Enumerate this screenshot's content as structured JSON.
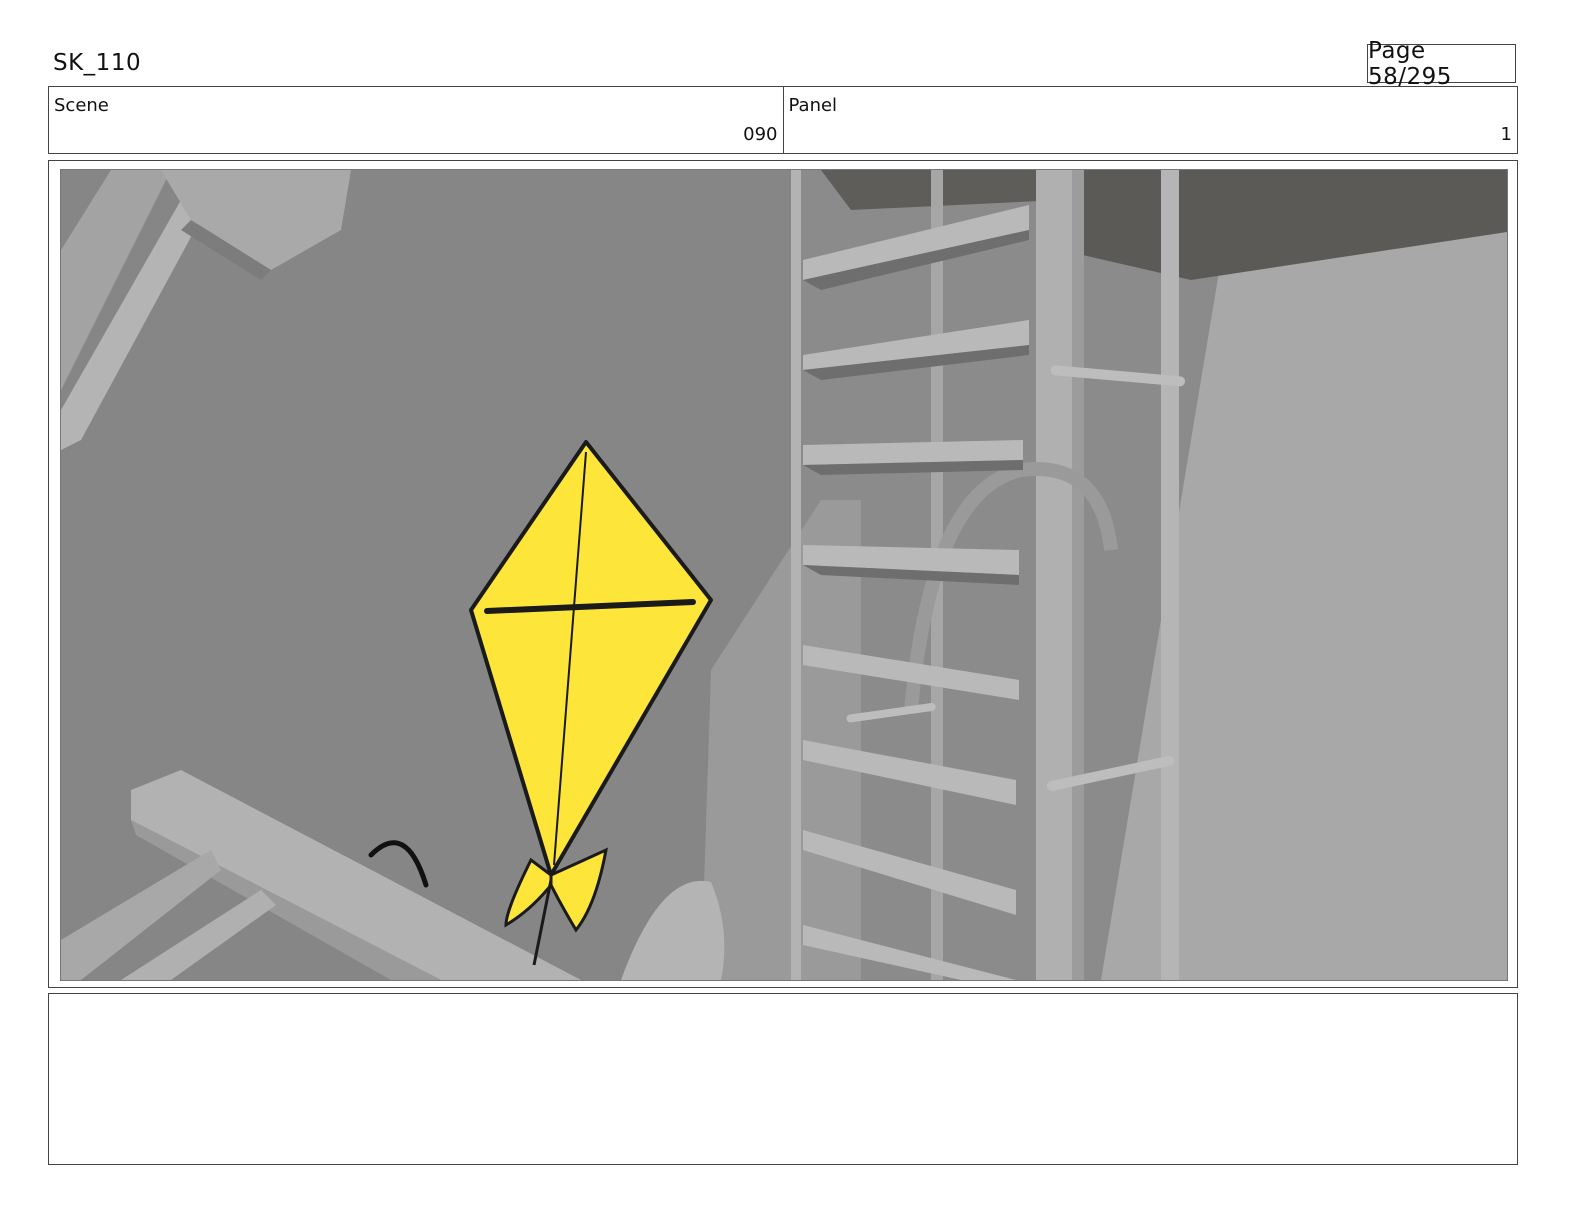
{
  "header": {
    "title": "SK_110",
    "page": "Page  58/295"
  },
  "info": {
    "scene_label": "Scene",
    "scene_value": "090",
    "panel_label": "Panel",
    "panel_value": "1"
  },
  "artwork": {
    "kite_color": "#fde53a",
    "background_color": "#8a8a8a"
  },
  "notes": {
    "text": ""
  }
}
